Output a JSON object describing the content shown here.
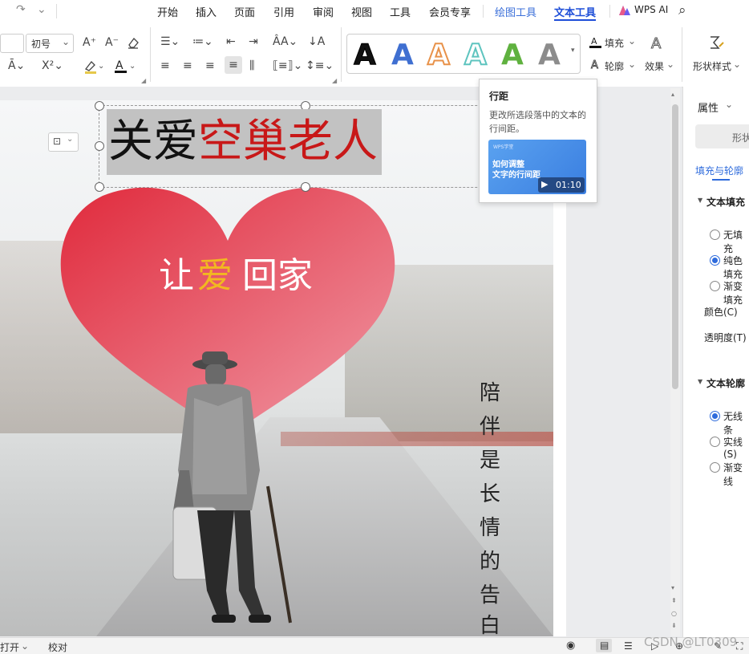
{
  "quick_access": {
    "redo_icon": "↷",
    "more_icon": "⌄"
  },
  "menu": {
    "items": [
      "开始",
      "插入",
      "页面",
      "引用",
      "审阅",
      "视图",
      "工具",
      "会员专享"
    ],
    "drawing_tools": "绘图工具",
    "text_tools": "文本工具",
    "wps_ai": "WPS AI",
    "search_icon": "⌕"
  },
  "ribbon": {
    "font_size": "初号",
    "fill_label": "填充",
    "outline_label": "轮廓",
    "effect_label": "效果",
    "shape_style_label": "形状样式",
    "style_glyph": "A",
    "style_colors": [
      "#111111",
      "#3f6fd1",
      "#e8924a",
      "#5ec4bf",
      "#5fb13f",
      "#8c8c8c"
    ]
  },
  "document": {
    "title_black": "关爱",
    "title_red": "空巢老人",
    "slogan_a": "让",
    "slogan_b": "爱",
    "slogan_c": "回家",
    "vertical_chars": [
      "陪",
      "伴",
      "是",
      "长",
      "情",
      "的",
      "告",
      "白"
    ]
  },
  "tooltip": {
    "title": "行距",
    "desc": "更改所选段落中的文本的行间距。",
    "thumb_brand": "WPS学堂",
    "thumb_line1": "如何调整",
    "thumb_line2": "文字的行间距",
    "duration": "01:10"
  },
  "panel": {
    "title": "属性",
    "shape_tab": "形状",
    "active_tab": "填充与轮廓",
    "text_fill_section": "文本填充",
    "fill_options": [
      "无填充",
      "纯色填充",
      "渐变填充"
    ],
    "color_label": "颜色(C)",
    "transparency_label": "透明度(T)",
    "text_outline_section": "文本轮廓",
    "outline_options": [
      "无线条",
      "实线(S)",
      "渐变线"
    ]
  },
  "status": {
    "left_item": "打开",
    "proofread": "校对",
    "watermark": "CSDN @LT0309"
  }
}
